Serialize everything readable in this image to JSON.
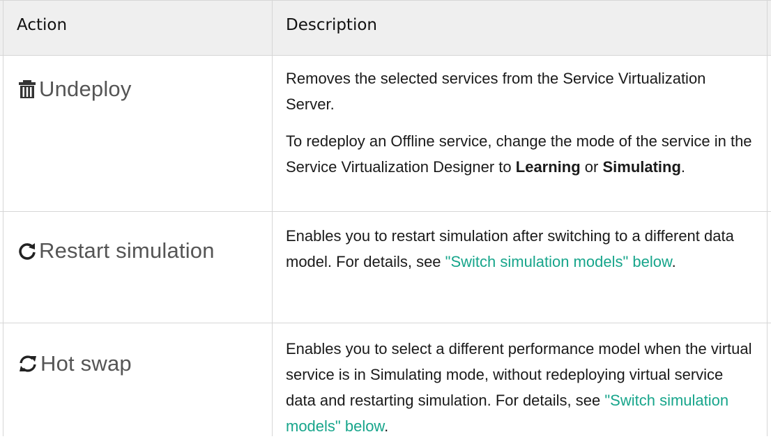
{
  "header": {
    "action": "Action",
    "description": "Description"
  },
  "rows": [
    {
      "action_label": "Undeploy",
      "icon": "trash-icon",
      "paragraph1": "Removes the selected services from the Service Virtualization Server.",
      "paragraph2": {
        "before": "To redeploy an Offline service, change the mode of the service in the Service Virtualization Designer to ",
        "bold1": "Learning",
        "middle": " or ",
        "bold2": "Simulating",
        "after": "."
      }
    },
    {
      "action_label": "Restart simulation",
      "icon": "refresh-icon",
      "text_before": "Enables you to restart simulation after switching to a different data model. For details, see ",
      "link": "\"Switch simulation models\" below",
      "text_after": "."
    },
    {
      "action_label": "Hot swap",
      "icon": "swap-arrows-icon",
      "text_before": "Enables you to select a different performance model when the virtual service is in Simulating mode, without redeploying virtual service data and restarting simulation. For details, see ",
      "link": "\"Switch simulation models\" below",
      "text_after": "."
    }
  ],
  "colors": {
    "link": "#17a58b",
    "header_bg": "#efefef",
    "border": "#d6d6d6"
  }
}
